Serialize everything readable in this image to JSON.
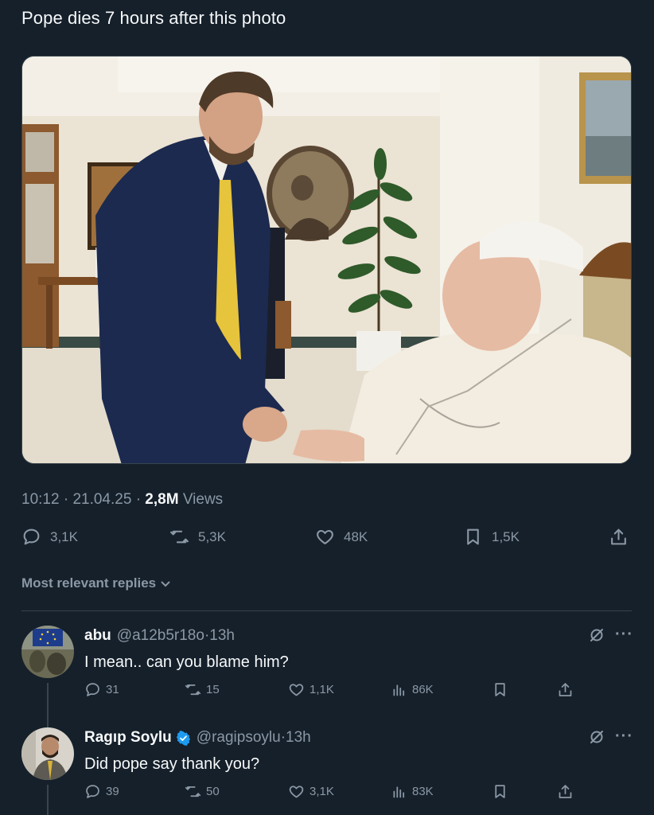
{
  "tweet": {
    "text": "Pope dies 7 hours after this photo",
    "time": "10:12",
    "date": "21.04.25",
    "views_count": "2,8M",
    "views_label": "Views"
  },
  "actions": {
    "replies": "3,1K",
    "reposts": "5,3K",
    "likes": "48K",
    "bookmarks": "1,5K"
  },
  "replies_sort": {
    "label": "Most relevant replies"
  },
  "replies": [
    {
      "name": "abu",
      "handle": "@a12b5r18o",
      "age": "13h",
      "text": "I mean.. can you blame him?",
      "replies": "31",
      "reposts": "15",
      "likes": "1,1K",
      "views": "86K",
      "verified": false
    },
    {
      "name": "Ragıp Soylu",
      "handle": "@ragipsoylu",
      "age": "13h",
      "text": "Did pope say thank you?",
      "replies": "39",
      "reposts": "50",
      "likes": "3,1K",
      "views": "83K",
      "verified": true
    }
  ],
  "colors": {
    "background": "#15202b",
    "secondary_text": "#8b98a5",
    "verified_blue": "#1d9bf0"
  }
}
